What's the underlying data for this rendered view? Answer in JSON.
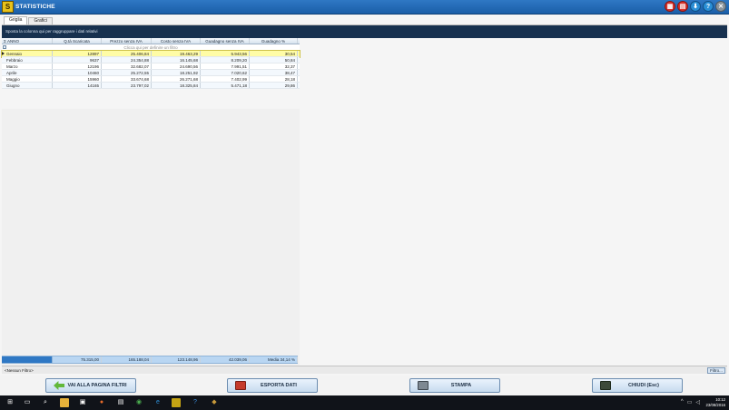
{
  "window": {
    "title": "STATISTICHE",
    "logo_letter": "S"
  },
  "title_icons": [
    {
      "name": "calendar-icon",
      "glyph": "▦",
      "color": "red"
    },
    {
      "name": "calculator-icon",
      "glyph": "▤",
      "color": "red"
    },
    {
      "name": "download-icon",
      "glyph": "⬇",
      "color": "blue"
    },
    {
      "name": "help-icon",
      "glyph": "?",
      "color": "blue"
    },
    {
      "name": "close-icon",
      "glyph": "✕",
      "color": "gray"
    }
  ],
  "tabs": [
    {
      "label": "Griglia",
      "active": true
    },
    {
      "label": "Grafici",
      "active": false
    }
  ],
  "group_panel": {
    "text": "Sposta la colonna qui per raggruppare i dati relativi"
  },
  "grid": {
    "headers": [
      "ANNO",
      "Q.tà Scaricata",
      "Prezzo senza IVA",
      "Costo senza IVA",
      "Guadagno senza IVA",
      "Guadagno %"
    ],
    "filter_hint": "Clicca qui per definire un filtro",
    "rows": [
      {
        "anno": "Gennaio",
        "qta": "12897",
        "prezzo": "25.406,84",
        "costo": "19.463,29",
        "guadagno": "5.943,56",
        "perc": "30,54"
      },
      {
        "anno": "Febbraio",
        "qta": "9637",
        "prezzo": "24.354,88",
        "costo": "16.145,68",
        "guadagno": "8.209,20",
        "perc": "50,84"
      },
      {
        "anno": "Marzo",
        "qta": "12196",
        "prezzo": "32.682,07",
        "costo": "24.690,56",
        "guadagno": "7.991,51",
        "perc": "32,37"
      },
      {
        "anno": "Aprile",
        "qta": "10460",
        "prezzo": "25.272,55",
        "costo": "18.251,92",
        "guadagno": "7.020,62",
        "perc": "38,47"
      },
      {
        "anno": "Maggio",
        "qta": "15960",
        "prezzo": "33.674,68",
        "costo": "26.271,68",
        "guadagno": "7.402,99",
        "perc": "28,18"
      },
      {
        "anno": "Giugno",
        "qta": "14165",
        "prezzo": "23.797,02",
        "costo": "18.325,84",
        "guadagno": "5.471,18",
        "perc": "29,86"
      }
    ],
    "totals": {
      "qta": "75.315,00",
      "prezzo": "165.188,04",
      "costo": "123.148,96",
      "guadagno": "42.039,06",
      "perc": "Media 34,14 %"
    }
  },
  "filter_status": {
    "text": "<Nessun Filtro>",
    "button": "Filtro..."
  },
  "buttons": {
    "filters": "VAI ALLA PAGINA FILTRI",
    "export": "ESPORTA DATI",
    "print": "STAMPA",
    "close": "CHIUDI  (Esc)"
  },
  "taskbar": {
    "time": "10:12",
    "date": "23/08/2016"
  }
}
